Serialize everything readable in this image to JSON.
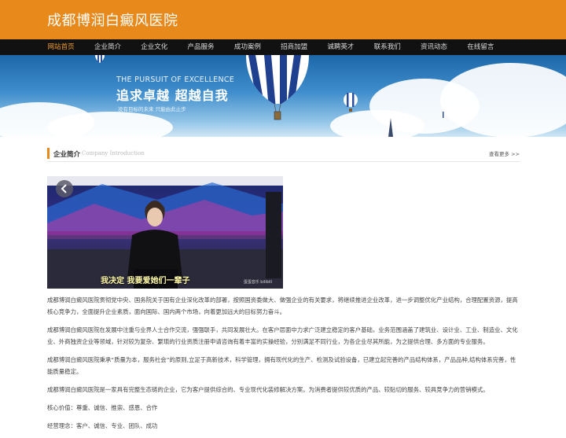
{
  "header": {
    "site_title": "成都博润白癜风医院"
  },
  "nav": {
    "items": [
      {
        "label": "网站首页",
        "active": true
      },
      {
        "label": "企业简介",
        "active": false
      },
      {
        "label": "企业文化",
        "active": false
      },
      {
        "label": "产品服务",
        "active": false
      },
      {
        "label": "成功案例",
        "active": false
      },
      {
        "label": "招商加盟",
        "active": false
      },
      {
        "label": "诚聘英才",
        "active": false
      },
      {
        "label": "联系我们",
        "active": false
      },
      {
        "label": "资讯动态",
        "active": false
      },
      {
        "label": "在线留言",
        "active": false
      }
    ]
  },
  "banner": {
    "tagline_en": "THE PURSUIT OF EXCELLENCE",
    "tagline_cn": "追求卓越  超越自我",
    "tagline_sub": "没有目标的未来  只能由此止步"
  },
  "section": {
    "title": "企业简介",
    "title_en": "Company Introduction",
    "more": "查看更多 >>"
  },
  "photo": {
    "caption": "我决定  我要爱她们一辈子",
    "watermark": "蛋蛋音乐 bilibili"
  },
  "article": {
    "paragraphs": [
      "成都博润白癜风医院贯彻党中央、国务院关于国有企业深化改革的部署，按照国资委做大、做强企业的有关要求，将继续推进企业改革，进一步调整优化产业结构，合理配置资源，提高核心竞争力，全面提升企业素质，面向国际、国内两个市场，向着更加远大的目标努力奋斗。",
      "成都博润白癜风医院在发展中注重与业界人士合作交流，强强联手，共同发展壮大。在客户层面中力求广泛建立稳定的客户基础，业务范围涵盖了建筑业、设计业、工业、制造业、文化业、外商独资企业等领域，针对较为复杂、繁琐的行业资质注册申请咨询有着丰富的实操经验，分别满足不同行业，为各企业尽其所能，为之提供合理、多方面的专业服务。",
      "成都博润白癜风医院秉承“质量为本，服务社会”的原则,立足于高新技术，科学管理，拥有现代化的生产、检测及试验设备，已建立起完善的产品结构体系，产品品种,结构体系完善，性能质量稳定。",
      "成都博润白癜风医院是一家具有完整生态链的企业，它为客户提供综合的、专业现代化装修解决方案。为消费者提供较优质的产品、较贴切的服务、较具竞争力的营销模式。",
      "核心价值：尊重、诚信、推崇、感恩、合作",
      "经营理念：客户、诚信、专业、团队、成功"
    ]
  },
  "colors": {
    "brand_orange": "#e8891b",
    "nav_bg": "#111111",
    "nav_active": "#f09a2c"
  },
  "icons": {
    "prev_arrow": "chevron-left-icon"
  }
}
